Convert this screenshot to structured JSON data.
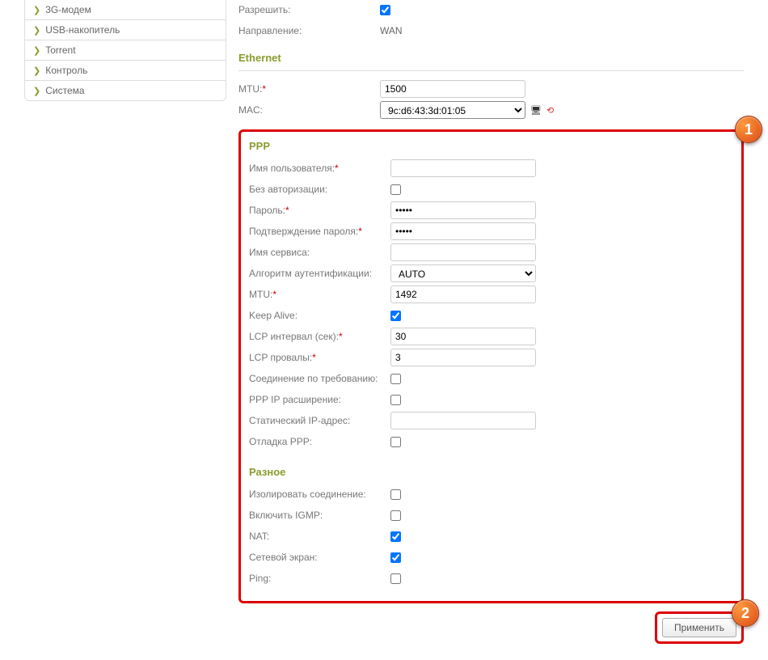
{
  "sidebar": {
    "items": [
      {
        "label": "3G-модем"
      },
      {
        "label": "USB-накопитель"
      },
      {
        "label": "Torrent"
      },
      {
        "label": "Контроль"
      },
      {
        "label": "Система"
      }
    ]
  },
  "top": {
    "allow_label": "Разрешить:",
    "direction_label": "Направление:",
    "direction_value": "WAN"
  },
  "ethernet": {
    "title": "Ethernet",
    "mtu_label": "MTU:",
    "mtu_value": "1500",
    "mac_label": "MAC:",
    "mac_value": "9c:d6:43:3d:01:05"
  },
  "ppp": {
    "title": "PPP",
    "username_label": "Имя пользователя:",
    "noauth_label": "Без авторизации:",
    "password_label": "Пароль:",
    "password_value": "•••••",
    "confirm_label": "Подтверждение пароля:",
    "confirm_value": "•••••",
    "service_label": "Имя сервиса:",
    "auth_label": "Алгоритм аутентификации:",
    "auth_value": "AUTO",
    "mtu_label": "MTU:",
    "mtu_value": "1492",
    "keepalive_label": "Keep Alive:",
    "lcp_interval_label": "LCP интервал (сек):",
    "lcp_interval_value": "30",
    "lcp_fail_label": "LCP провалы:",
    "lcp_fail_value": "3",
    "ondemand_label": "Соединение по требованию:",
    "ipext_label": "PPP IP расширение:",
    "staticip_label": "Статический IP-адрес:",
    "debug_label": "Отладка PPP:"
  },
  "misc": {
    "title": "Разное",
    "isolate_label": "Изолировать соединение:",
    "igmp_label": "Включить IGMP:",
    "nat_label": "NAT:",
    "firewall_label": "Сетевой экран:",
    "ping_label": "Ping:"
  },
  "footer": {
    "apply": "Применить"
  },
  "callouts": {
    "c1": "1",
    "c2": "2"
  }
}
